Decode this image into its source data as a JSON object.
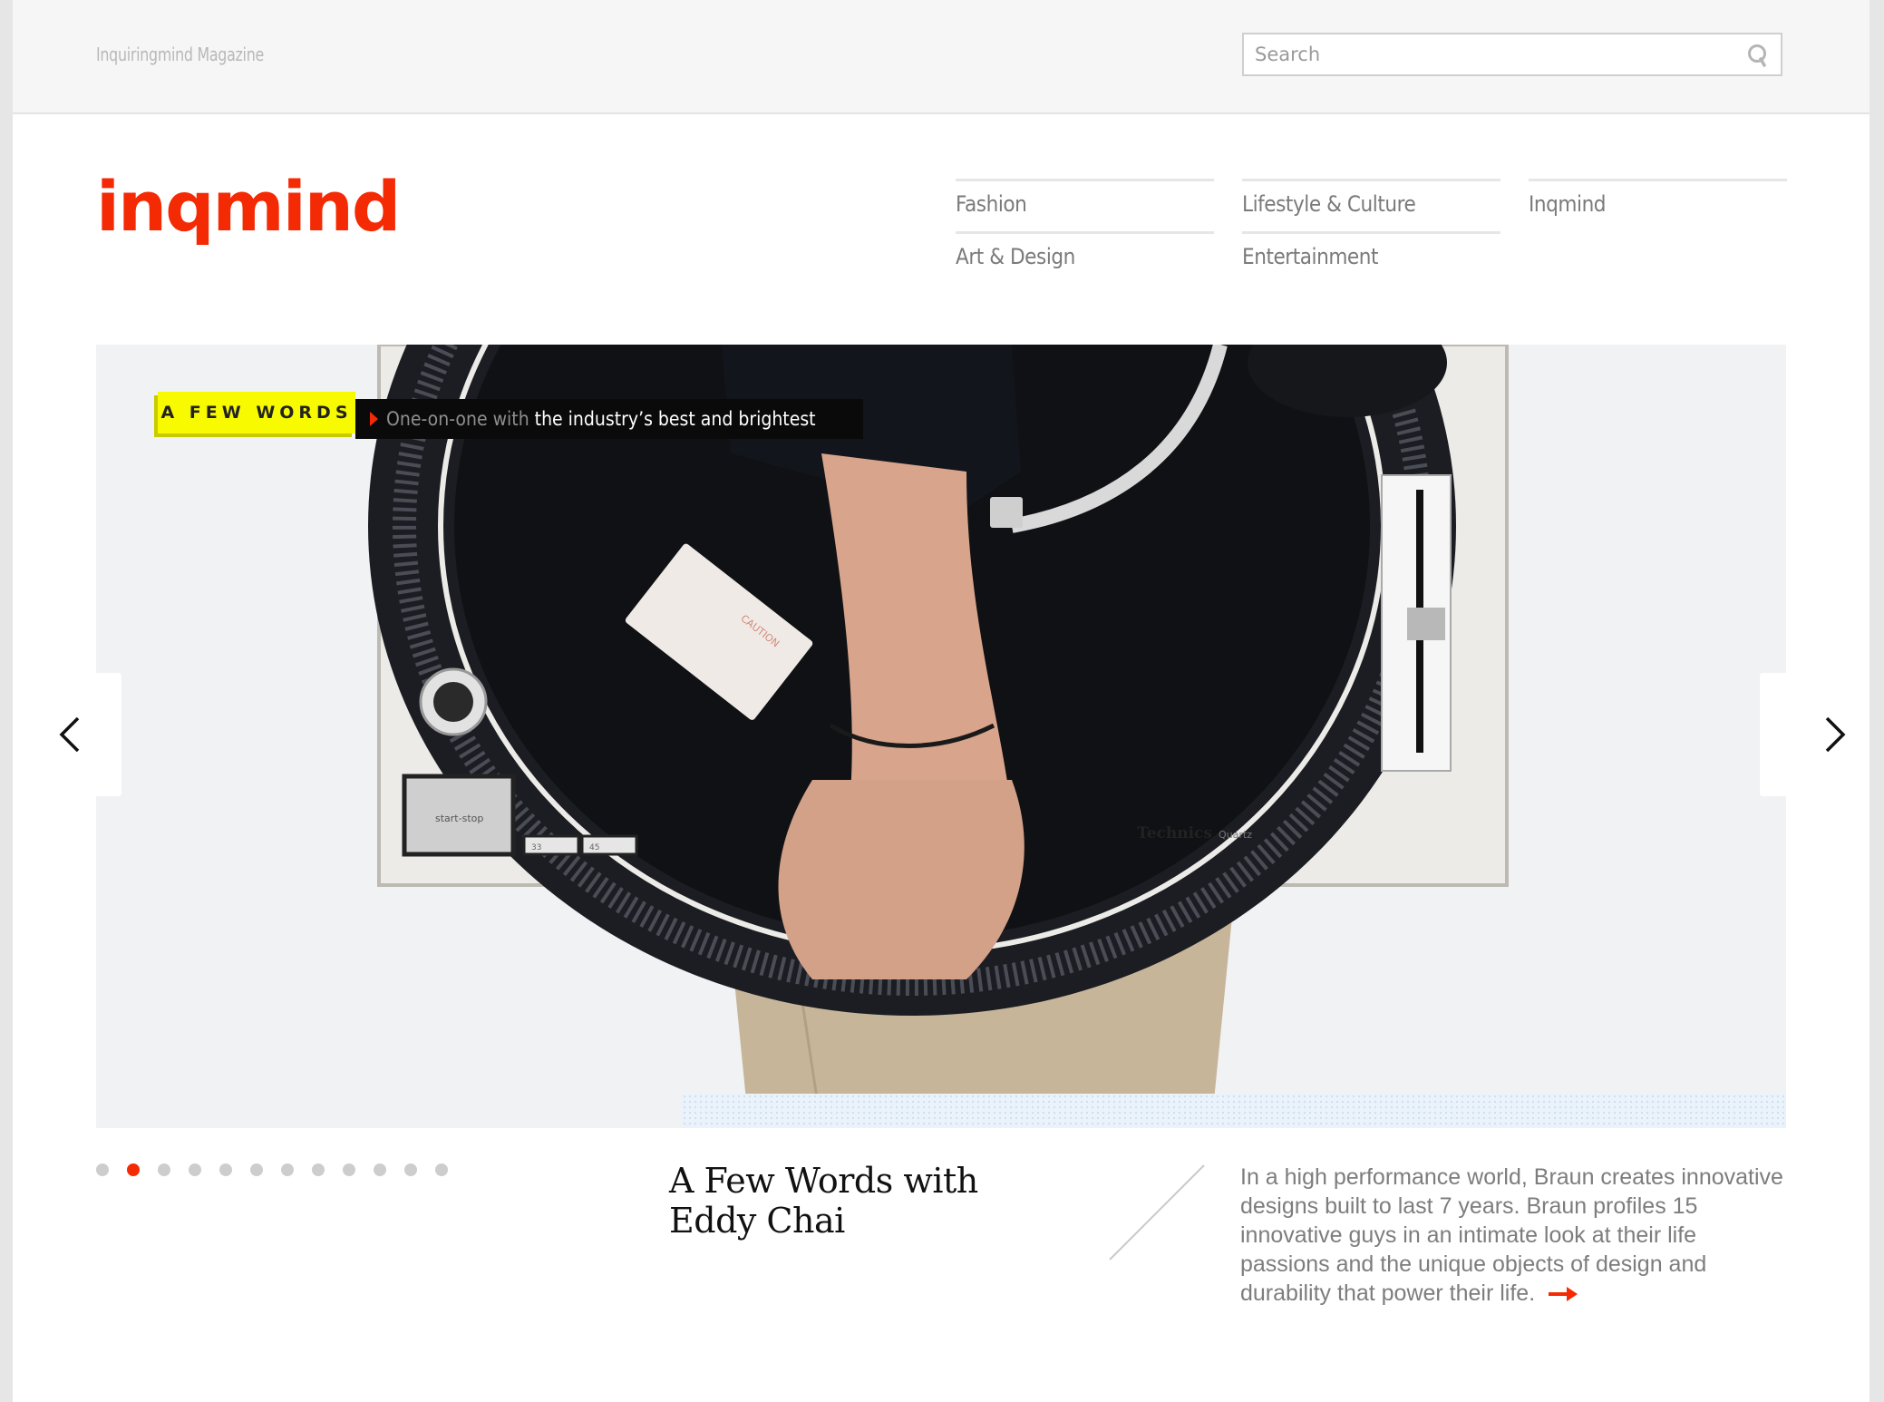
{
  "header": {
    "site_name": "Inquiringmind Magazine",
    "search": {
      "placeholder": "Search",
      "value": "",
      "icon": "search-icon"
    }
  },
  "brand": {
    "logo_text": "inqmind",
    "accent_color": "#f42a04"
  },
  "nav": {
    "items": [
      {
        "label": "Fashion"
      },
      {
        "label": "Lifestyle & Culture"
      },
      {
        "label": "Inqmind"
      },
      {
        "label": "Art & Design"
      },
      {
        "label": "Entertainment"
      }
    ]
  },
  "hero": {
    "badge_label": "A FEW WORDS",
    "tagline_muted": "One-on-one with",
    "tagline_bright": "the industry’s best and brightest",
    "image_alt": "Person carrying a Technics turntable",
    "image_texts": {
      "caution": "CAUTION",
      "button": "start-stop",
      "speed_33": "33",
      "speed_45": "45",
      "brand": "Technics",
      "brand_sub": "Quartz"
    },
    "prev_icon": "chevron-left-icon",
    "next_icon": "chevron-right-icon",
    "badge_color": "#f8fa00"
  },
  "carousel": {
    "slide_count": 12,
    "active_index": 1
  },
  "article": {
    "title": "A Few Words with Eddy Chai",
    "description": "In a high performance world, Braun creates innovative designs built to last 7 years. Braun profiles 15 innovative guys in an intimate look at their life passions and the unique objects of design and durability that power their life.",
    "read_more_icon": "arrow-right-icon"
  }
}
